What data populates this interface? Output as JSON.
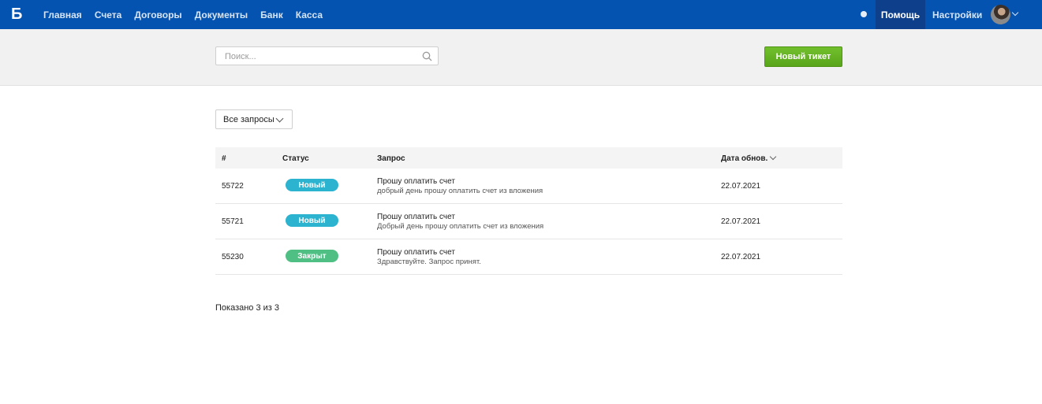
{
  "nav": {
    "logo": "Б",
    "items": [
      "Главная",
      "Счета",
      "Договоры",
      "Документы",
      "Банк",
      "Касса"
    ],
    "help": "Помощь",
    "settings": "Настройки"
  },
  "search": {
    "placeholder": "Поиск..."
  },
  "actions": {
    "new_ticket": "Новый тикет"
  },
  "filter": {
    "selected": "Все запросы"
  },
  "table": {
    "headers": {
      "id": "#",
      "status": "Статус",
      "request": "Запрос",
      "date": "Дата обнов."
    },
    "rows": [
      {
        "id": "55722",
        "status": "Новый",
        "status_color": "#2bb3cf",
        "title": "Прошу оплатить счет",
        "desc": "добрый день прошу оплатить счет из вложения",
        "date": "22.07.2021"
      },
      {
        "id": "55721",
        "status": "Новый",
        "status_color": "#2bb3cf",
        "title": "Прошу оплатить счет",
        "desc": "Добрый день прошу оплатить счет из вложения",
        "date": "22.07.2021"
      },
      {
        "id": "55230",
        "status": "Закрыт",
        "status_color": "#4fbf83",
        "title": "Прошу оплатить счет",
        "desc": "Здравствуйте. Запрос принят.",
        "date": "22.07.2021"
      }
    ]
  },
  "footer": {
    "count_text": "Показано 3 из 3"
  },
  "colors": {
    "topbar": "#0453b0",
    "accent_green": "#5aa51b"
  }
}
